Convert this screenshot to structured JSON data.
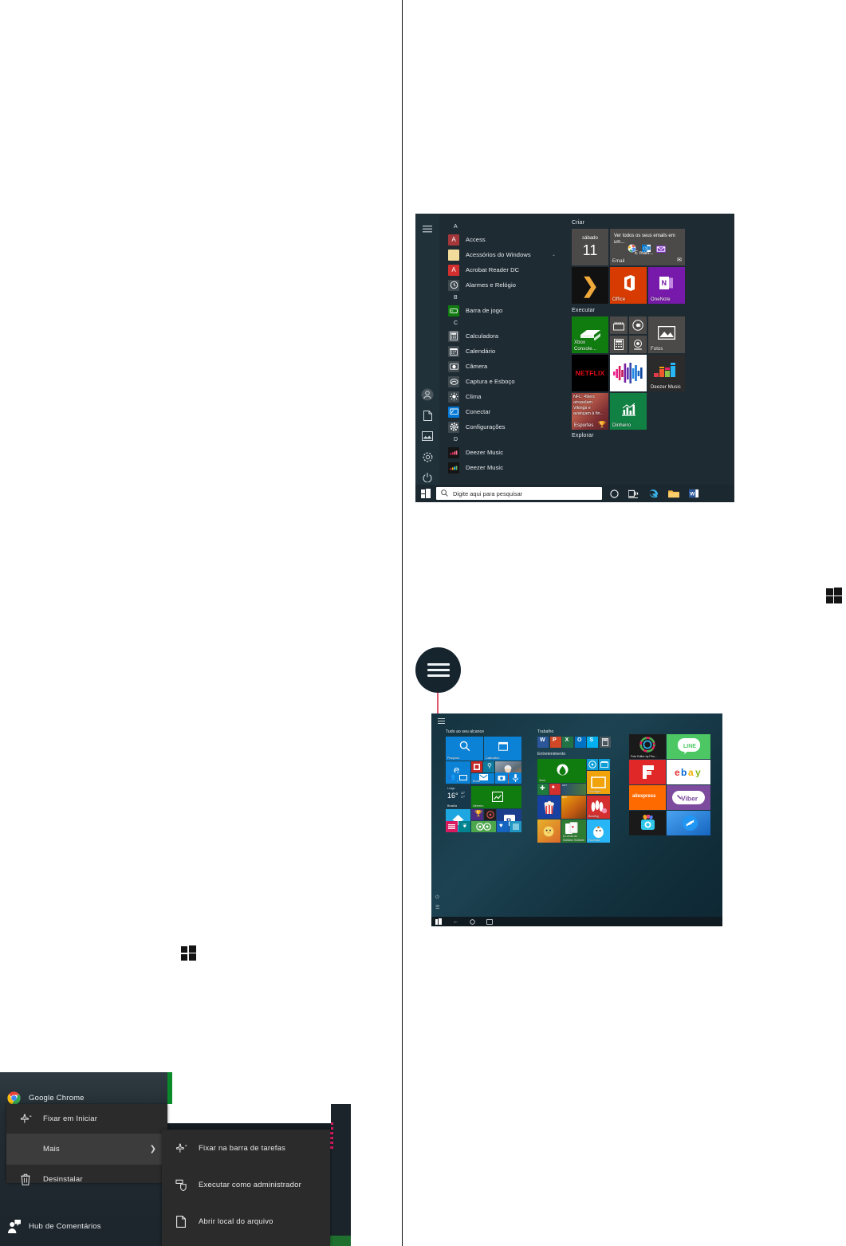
{
  "figure_start_menu": {
    "rail_icons": [
      "hamburger-icon",
      "user-account-icon",
      "documents-icon",
      "pictures-icon",
      "settings-gear-icon",
      "power-icon"
    ],
    "app_list": [
      {
        "type": "letter",
        "label": "A"
      },
      {
        "type": "app",
        "label": "Access",
        "icon": "access-icon",
        "color": "#A4373A",
        "glyph": "A"
      },
      {
        "type": "app",
        "label": "Acessórios do Windows",
        "icon": "folder-icon",
        "color": "#F2DC9B",
        "glyph": "",
        "expandable": true,
        "chevron": "⌄"
      },
      {
        "type": "app",
        "label": "Acrobat Reader DC",
        "icon": "acrobat-icon",
        "color": "#D32F2F",
        "glyph": "A"
      },
      {
        "type": "app",
        "label": "Alarmes e Relógio",
        "icon": "alarm-clock-icon",
        "color": "#3F4A50",
        "glyph": "◷"
      },
      {
        "type": "letter",
        "label": "B"
      },
      {
        "type": "app",
        "label": "Barra de jogo",
        "icon": "game-bar-icon",
        "color": "#107C10",
        "glyph": "▣"
      },
      {
        "type": "letter",
        "label": "C"
      },
      {
        "type": "app",
        "label": "Calculadora",
        "icon": "calculator-icon",
        "color": "#3F4A50",
        "glyph": "▦"
      },
      {
        "type": "app",
        "label": "Calendário",
        "icon": "calendar-icon",
        "color": "#3F4A50",
        "glyph": "▤"
      },
      {
        "type": "app",
        "label": "Câmera",
        "icon": "camera-icon",
        "color": "#3F4A50",
        "glyph": "◉"
      },
      {
        "type": "app",
        "label": "Captura e Esboço",
        "icon": "snip-sketch-icon",
        "color": "#3F4A50",
        "glyph": "✂"
      },
      {
        "type": "app",
        "label": "Clima",
        "icon": "weather-icon",
        "color": "#3F4A50",
        "glyph": "☀"
      },
      {
        "type": "app",
        "label": "Conectar",
        "icon": "connect-icon",
        "color": "#0078D7",
        "glyph": "🖵"
      },
      {
        "type": "app",
        "label": "Configurações",
        "icon": "settings-gear-icon",
        "color": "#3F4A50",
        "glyph": "⚙"
      },
      {
        "type": "letter",
        "label": "D"
      },
      {
        "type": "app",
        "label": "Deezer Music",
        "icon": "deezer-icon",
        "color": "#1a1a1a",
        "glyph": "▂▄"
      },
      {
        "type": "app",
        "label": "Deezer Music",
        "icon": "deezer-icon",
        "color": "#1a1a1a",
        "glyph": "▂▄"
      }
    ],
    "tile_groups": [
      {
        "header": "Criar",
        "tiles": [
          {
            "name": "calendar-tile",
            "label": "",
            "size": "medium",
            "color": "#4C4A48",
            "day_name": "sábado",
            "day_number": "11"
          },
          {
            "name": "mail-tile",
            "label": "Email",
            "size": "wide",
            "color": "#4C4A48",
            "headline": "Ver todos os seus emails em um...",
            "sub": "E mais..."
          },
          {
            "name": "movies-tv-tile",
            "label": "",
            "size": "medium",
            "color": "#111111",
            "glyph": "❯"
          },
          {
            "name": "office-tile",
            "label": "Office",
            "size": "medium",
            "color": "#D83B01"
          },
          {
            "name": "onenote-tile",
            "label": "OneNote",
            "size": "medium",
            "color": "#7719AA"
          }
        ]
      },
      {
        "header": "Executar",
        "tiles": [
          {
            "name": "xbox-console-companion-tile",
            "label": "Xbox Console...",
            "size": "medium",
            "color": "#107C10"
          },
          {
            "name": "movies-small-tile",
            "label": "",
            "size": "small",
            "color": "#4C4A48"
          },
          {
            "name": "groove-music-small-tile",
            "label": "",
            "size": "small",
            "color": "#4C4A48"
          },
          {
            "name": "calculator-small-tile",
            "label": "",
            "size": "small",
            "color": "#4C4A48"
          },
          {
            "name": "camera-small-tile",
            "label": "",
            "size": "small",
            "color": "#4C4A48"
          },
          {
            "name": "fotos-tile",
            "label": "Fotos",
            "size": "medium",
            "color": "#4C4A48"
          },
          {
            "name": "netflix-tile",
            "label": "NETFLIX",
            "size": "medium",
            "color": "#000000"
          },
          {
            "name": "music-visualizer-tile",
            "label": "",
            "size": "medium",
            "color": "#FFFFFF"
          },
          {
            "name": "deezer-music-tile",
            "label": "Deezer Music",
            "size": "medium",
            "color": "#2B2B2B"
          },
          {
            "name": "esportes-tile",
            "label": "Esportes",
            "size": "medium",
            "color": "#8B2A30",
            "headline": "NFL: 49ers atropelam Vikings e avançam à fin..."
          },
          {
            "name": "dinheiro-tile",
            "label": "Dinheiro",
            "size": "medium",
            "color": "#108043"
          }
        ]
      },
      {
        "header": "Explorar",
        "tiles": []
      }
    ],
    "taskbar": {
      "start_button": "windows-start-icon",
      "search_placeholder": "Digite aqui para pesquisar",
      "icons": [
        "cortana-circle-icon",
        "task-view-icon",
        "microsoft-edge-icon",
        "file-explorer-icon",
        "word-icon"
      ]
    }
  },
  "figure_tablet_start": {
    "hamburger_callout": "hamburger-menu-icon",
    "column_1": {
      "header": "Tudo ao seu alcance",
      "tiles": [
        {
          "name": "pesquisa-tile",
          "label": "Pesquisa",
          "color": "#0078D7"
        },
        {
          "name": "calendario-tile",
          "label": "Calendário",
          "color": "#0078D7"
        },
        {
          "name": "microsoft-edge-tile",
          "label": "Microsoft Edge",
          "color": "#0078D7"
        },
        {
          "name": "office-small-tile",
          "label": "",
          "color": "#C62828"
        },
        {
          "name": "flashlight-tile",
          "label": "",
          "color": "#0F7A9E"
        },
        {
          "name": "fotos-person-tile",
          "label": "",
          "color": "#7a6a5a"
        },
        {
          "name": "pessoas-tile",
          "label": "",
          "color": "#0078D7"
        },
        {
          "name": "conectar-tile",
          "label": "",
          "color": "#0078D7"
        },
        {
          "name": "email-tile",
          "label": "Email",
          "color": "#0078D7"
        },
        {
          "name": "camera-tile",
          "label": "",
          "color": "#0078D7"
        },
        {
          "name": "gravador-tile",
          "label": "",
          "color": "#0078D7"
        }
      ],
      "weather": {
        "name": "clima-tile",
        "header": "Longo",
        "temp": "16°",
        "hi": "22°",
        "lo": "17°",
        "city": "Brasília",
        "color": "#17384a"
      },
      "dinheiro": {
        "name": "dinheiro-tile",
        "label": "Dinheiro",
        "color": "#107C10"
      },
      "extra": [
        {
          "name": "casa-tile",
          "label": "",
          "color": "#00A0E3"
        },
        {
          "name": "trophy-tile",
          "label": "",
          "color": "#4B2E83"
        },
        {
          "name": "timer-tile",
          "label": "",
          "color": "#1F1F1F"
        },
        {
          "name": "onedrive-tile",
          "label": "",
          "color": "#1A3E8C"
        },
        {
          "name": "news-tile",
          "label": "",
          "color": "#D32F2F"
        },
        {
          "name": "evernote-tile",
          "label": "",
          "color": "#1F7A3D"
        },
        {
          "name": "tripadvisor-tile",
          "label": "",
          "color": "#4CA64C"
        },
        {
          "name": "health-tile",
          "label": "",
          "color": "#1565C0"
        },
        {
          "name": "store-tile",
          "label": "",
          "color": "#2196C4"
        }
      ]
    },
    "column_2": {
      "header": "Trabalho",
      "office_tiles": [
        {
          "name": "word-tile",
          "color": "#2B579A"
        },
        {
          "name": "powerpoint-tile",
          "color": "#D24726"
        },
        {
          "name": "excel-tile",
          "color": "#217346"
        },
        {
          "name": "outlook-tile",
          "color": "#0072C6"
        },
        {
          "name": "skype-tile",
          "color": "#00AFF0"
        },
        {
          "name": "calculadora-tile",
          "color": "#3F4A50"
        }
      ],
      "header2": "Entretenimento",
      "tiles": [
        {
          "name": "xbox-tile",
          "label": "Xbox",
          "color": "#107C10"
        },
        {
          "name": "groove-tile",
          "label": "",
          "color": "#0E9FD8"
        },
        {
          "name": "filmes-tile",
          "label": "",
          "color": "#0E9FD8"
        },
        {
          "name": "solitaire-tile",
          "label": "",
          "color": "#D32F2F"
        },
        {
          "name": "game-tile-1",
          "label": "",
          "color": "#1E7A3D"
        },
        {
          "name": "candy-tile",
          "label": "",
          "color": "#F0A30A"
        },
        {
          "name": "popcorn-tile",
          "label": "",
          "color": "#1840A0"
        },
        {
          "name": "nextflix-tile",
          "label": "Netflix",
          "color": "#F0C808"
        },
        {
          "name": "bowling-tile",
          "label": "",
          "color": "#D32F2F"
        },
        {
          "name": "chicken-tile",
          "label": "",
          "color": "#E8B12B"
        },
        {
          "name": "cards-tile",
          "label": "A Lenda do Solitário Solitaire",
          "color": "#2E7D32"
        },
        {
          "name": "farm-tile",
          "label": "Fazenda",
          "color": "#29B6F6"
        }
      ]
    },
    "column_3": {
      "tiles": [
        {
          "name": "photo-editor-tile",
          "label": "Foto Editor by Pho...",
          "color": "#1A1A1A"
        },
        {
          "name": "line-tile",
          "label": "LINE",
          "color": "#4CC764"
        },
        {
          "name": "flipboard-tile",
          "label": "",
          "color": "#E12828"
        },
        {
          "name": "ebay-tile",
          "label": "ebay",
          "color": "#FFFFFF"
        },
        {
          "name": "aliexpress-tile",
          "label": "",
          "color": "#FF6A00"
        },
        {
          "name": "viber-tile",
          "label": "Viber",
          "color": "#7D4B9E"
        },
        {
          "name": "picsart-tile",
          "label": "",
          "color": "#1A1A1A"
        },
        {
          "name": "shazam-tile",
          "label": "",
          "color": "#3FA9F5"
        }
      ]
    },
    "nav_bar": [
      "windows-start-icon",
      "back-arrow-icon",
      "cortana-circle-icon",
      "task-view-icon"
    ]
  },
  "figure_context_menu": {
    "background_list": [
      {
        "name": "google-chrome-item",
        "label": "Google Chrome",
        "icon": "chrome-icon"
      },
      {
        "name": "hub-comentarios-item",
        "label": "Hub de Comentários",
        "icon": "feedback-hub-icon"
      }
    ],
    "menu_primary": [
      {
        "name": "fixar-em-iniciar-item",
        "label": "Fixar em Iniciar",
        "icon": "pin-icon",
        "highlighted": false
      },
      {
        "name": "mais-item",
        "label": "Mais",
        "icon": "",
        "highlighted": true,
        "submenu_arrow": "❯"
      },
      {
        "name": "desinstalar-item",
        "label": "Desinstalar",
        "icon": "trash-icon",
        "highlighted": false
      }
    ],
    "menu_submenu": [
      {
        "name": "fixar-barra-tarefas-item",
        "label": "Fixar na barra de tarefas",
        "icon": "pin-taskbar-icon"
      },
      {
        "name": "executar-admin-item",
        "label": "Executar como administrador",
        "icon": "shield-run-icon"
      },
      {
        "name": "abrir-local-arquivo-item",
        "label": "Abrir local do arquivo",
        "icon": "file-icon"
      }
    ]
  },
  "inline_icons": {
    "windows_logo_right": "windows-logo-icon",
    "windows_logo_left": "windows-logo-icon"
  },
  "colors": {
    "start_bg": "#1f2b33",
    "taskbar": "#1b2830",
    "accent_blue": "#0078D7",
    "menu_bg": "#2b2b2b",
    "menu_highlight": "#3c3c3c",
    "callout_circle": "#16242e",
    "callout_line": "#e0586b"
  }
}
